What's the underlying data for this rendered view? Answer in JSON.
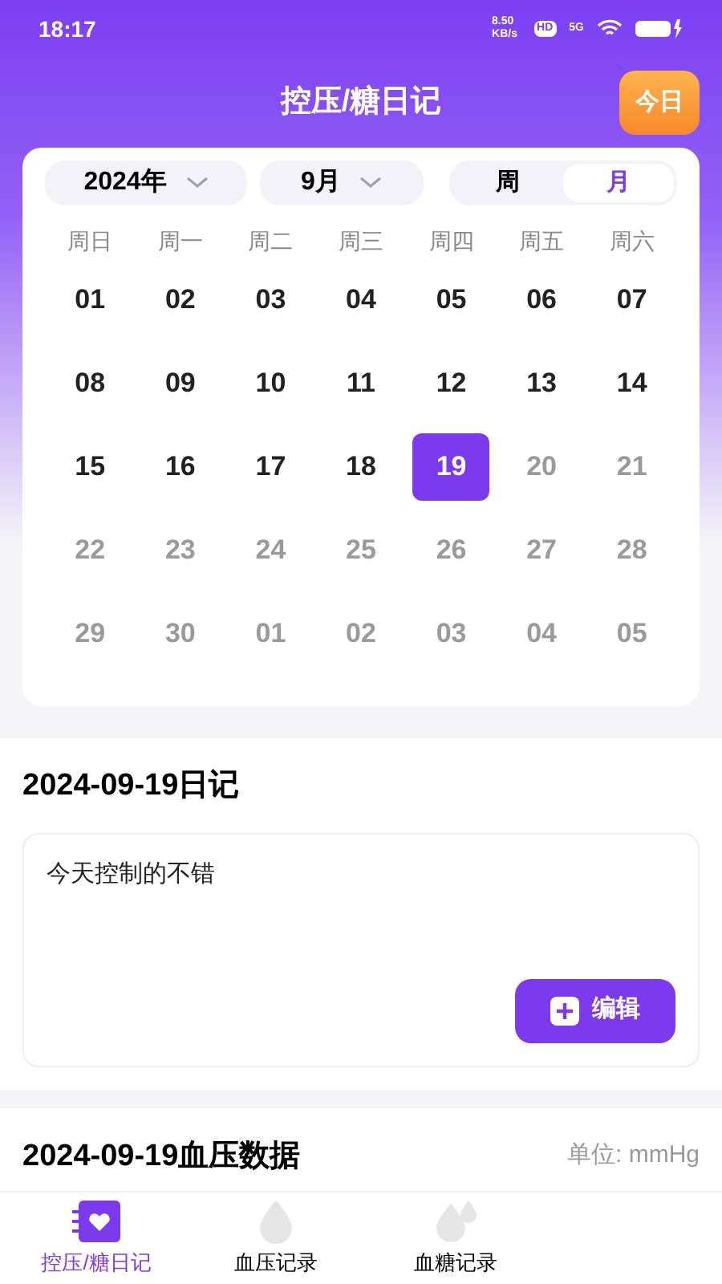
{
  "status_bar": {
    "time": "18:17",
    "speed": "8.50 KB/s",
    "hd": "HD",
    "network": "5G"
  },
  "header": {
    "title": "控压/糖日记",
    "today_button": "今日"
  },
  "calendar": {
    "year": "2024年",
    "month": "9月",
    "modes": [
      {
        "label": "周",
        "selected": false
      },
      {
        "label": "月",
        "selected": true
      }
    ],
    "weekdays": [
      "周日",
      "周一",
      "周二",
      "周三",
      "周四",
      "周五",
      "周六"
    ],
    "days": [
      {
        "label": "01",
        "muted": false,
        "selected": false
      },
      {
        "label": "02",
        "muted": false,
        "selected": false
      },
      {
        "label": "03",
        "muted": false,
        "selected": false
      },
      {
        "label": "04",
        "muted": false,
        "selected": false
      },
      {
        "label": "05",
        "muted": false,
        "selected": false
      },
      {
        "label": "06",
        "muted": false,
        "selected": false
      },
      {
        "label": "07",
        "muted": false,
        "selected": false
      },
      {
        "label": "08",
        "muted": false,
        "selected": false
      },
      {
        "label": "09",
        "muted": false,
        "selected": false
      },
      {
        "label": "10",
        "muted": false,
        "selected": false
      },
      {
        "label": "11",
        "muted": false,
        "selected": false
      },
      {
        "label": "12",
        "muted": false,
        "selected": false
      },
      {
        "label": "13",
        "muted": false,
        "selected": false
      },
      {
        "label": "14",
        "muted": false,
        "selected": false
      },
      {
        "label": "15",
        "muted": false,
        "selected": false
      },
      {
        "label": "16",
        "muted": false,
        "selected": false
      },
      {
        "label": "17",
        "muted": false,
        "selected": false
      },
      {
        "label": "18",
        "muted": false,
        "selected": false
      },
      {
        "label": "19",
        "muted": false,
        "selected": true
      },
      {
        "label": "20",
        "muted": true,
        "selected": false
      },
      {
        "label": "21",
        "muted": true,
        "selected": false
      },
      {
        "label": "22",
        "muted": true,
        "selected": false
      },
      {
        "label": "23",
        "muted": true,
        "selected": false
      },
      {
        "label": "24",
        "muted": true,
        "selected": false
      },
      {
        "label": "25",
        "muted": true,
        "selected": false
      },
      {
        "label": "26",
        "muted": true,
        "selected": false
      },
      {
        "label": "27",
        "muted": true,
        "selected": false
      },
      {
        "label": "28",
        "muted": true,
        "selected": false
      },
      {
        "label": "29",
        "muted": true,
        "selected": false
      },
      {
        "label": "30",
        "muted": true,
        "selected": false
      },
      {
        "label": "01",
        "muted": true,
        "selected": false
      },
      {
        "label": "02",
        "muted": true,
        "selected": false
      },
      {
        "label": "03",
        "muted": true,
        "selected": false
      },
      {
        "label": "04",
        "muted": true,
        "selected": false
      },
      {
        "label": "05",
        "muted": true,
        "selected": false
      }
    ]
  },
  "diary": {
    "title": "2024-09-19日记",
    "text": "今天控制的不错",
    "edit_button": "编辑"
  },
  "bp_data": {
    "title": "2024-09-19血压数据",
    "unit": "单位: mmHg"
  },
  "tab_bar": [
    {
      "label": "控压/糖日记",
      "selected": true
    },
    {
      "label": "血压记录",
      "selected": false
    },
    {
      "label": "血糖记录",
      "selected": false
    }
  ]
}
